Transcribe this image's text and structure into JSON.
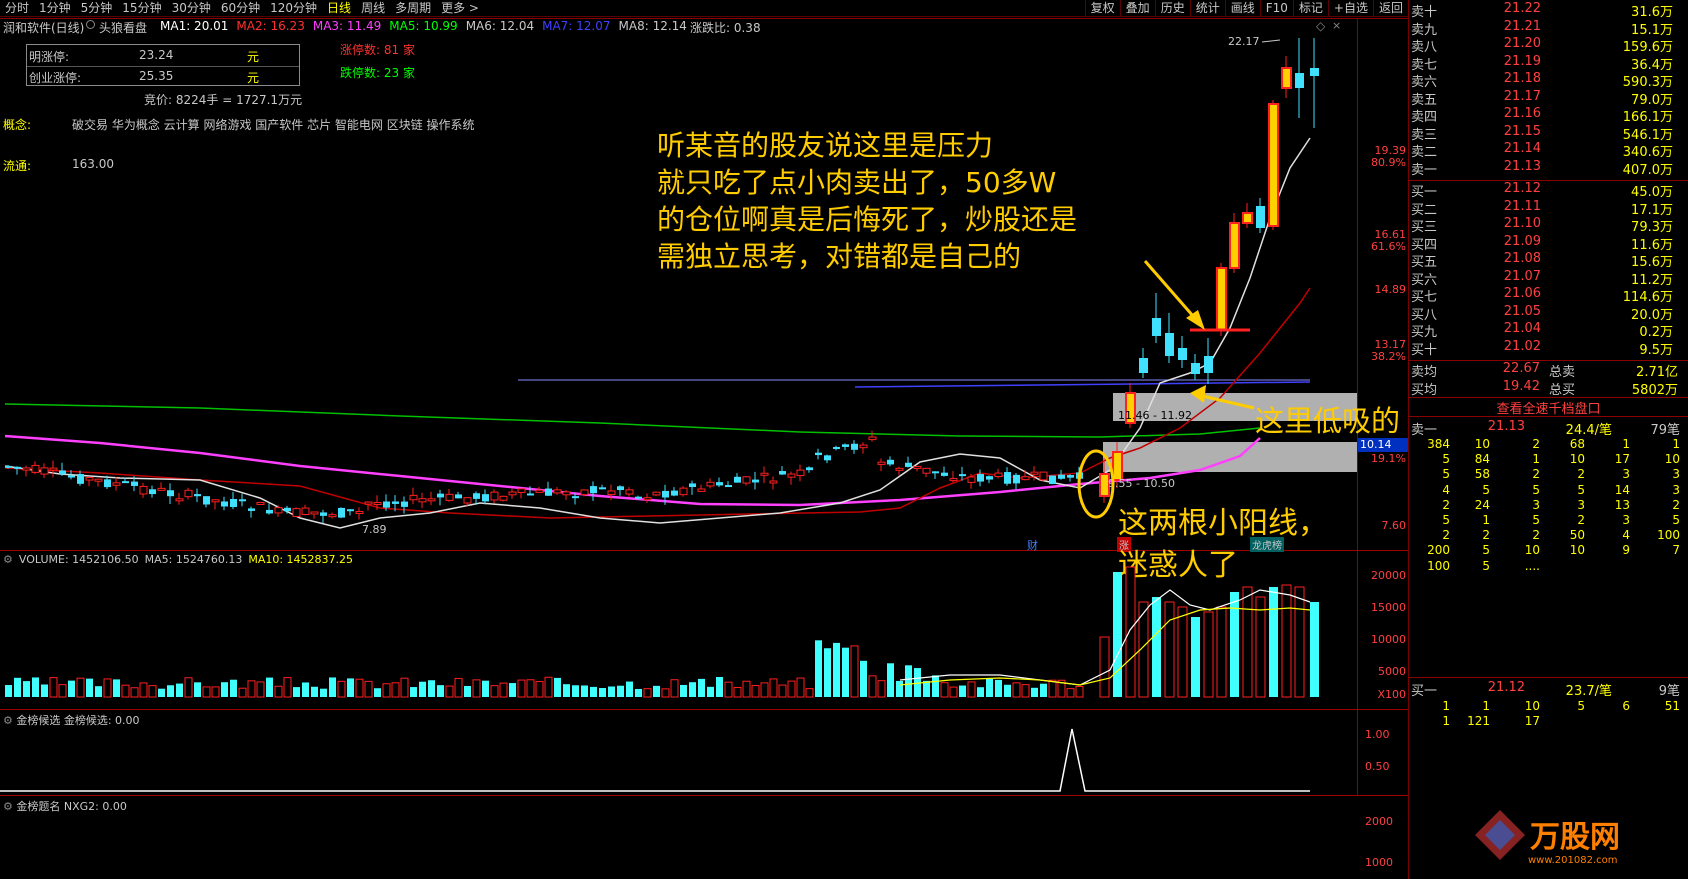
{
  "toolbar": {
    "periods": [
      "分时",
      "1分钟",
      "5分钟",
      "15分钟",
      "30分钟",
      "60分钟",
      "120分钟",
      "日线",
      "周线",
      "多周期",
      "更多 >"
    ],
    "active_period": "日线",
    "tools": [
      "复权",
      "叠加",
      "历史",
      "统计",
      "画线",
      "F10",
      "标记",
      "+自选",
      "返回"
    ]
  },
  "header": {
    "stock_name": "润和软件(日线)",
    "plugin": "头狼看盘",
    "ma": [
      {
        "label": "MA1: 20.01",
        "color": "#ffffff"
      },
      {
        "label": "MA2: 16.23",
        "color": "#ff3030"
      },
      {
        "label": "MA3: 11.49",
        "color": "#ff40ff"
      },
      {
        "label": "MA5: 10.99",
        "color": "#00ff00"
      },
      {
        "label": "MA6: 12.04",
        "color": "#c8c8c8"
      },
      {
        "label": "MA7: 12.07",
        "color": "#4040ff"
      },
      {
        "label": "MA8: 12.14",
        "color": "#c8c8c8"
      }
    ],
    "rise_fall_ratio": "涨跌比: 0.38"
  },
  "info_box": {
    "row1_label": "明涨停:",
    "row1_value": "23.24",
    "row1_unit": "元",
    "row2_label": "创业涨停:",
    "row2_value": "25.35",
    "row2_unit": "元",
    "bid": "竞价:  8224手 = 1727.1万元"
  },
  "limit_counts": {
    "up": "涨停数: 81 家",
    "down": "跌停数: 23 家"
  },
  "concepts": {
    "label": "概念:",
    "value": "破交易 华为概念 云计算 网络游戏 国产软件 芯片 智能电网 区块链 操作系统"
  },
  "float": {
    "label": "流通:",
    "value": "163.00"
  },
  "price_axis": [
    {
      "price": "19.39",
      "pct": "80.9%"
    },
    {
      "price": "16.61",
      "pct": "61.6%"
    },
    {
      "price": "14.89",
      "pct": ""
    },
    {
      "price": "13.17",
      "pct": "38.2%"
    },
    {
      "price": "10.14",
      "pct": "19.1%"
    },
    {
      "price": "7.60",
      "pct": ""
    }
  ],
  "chart_marks": {
    "high": "22.17",
    "low": "7.89",
    "zone_upper": "11.46 - 11.92",
    "zone_lower": "9.55 - 10.50",
    "tag_cai": "财",
    "tag_zhang": "涨",
    "tag_longhu": "龙虎榜"
  },
  "annotations": {
    "main_lines": [
      "听某音的股友说这里是压力",
      "就只吃了点小肉卖出了，50多W",
      " 的仓位啊真是后悔死了，炒股还是",
      "需独立思考，对错都是自己的"
    ],
    "low_buy": "这里低吸的",
    "two_yang": [
      "这两根小阳线，",
      "迷惑人了"
    ]
  },
  "volume": {
    "title": "VOLUME: 1452106.50",
    "ma5": "MA5: 1524760.13",
    "ma10": "MA10: 1452837.25",
    "axis": [
      "20000",
      "15000",
      "10000",
      "5000",
      "X100"
    ]
  },
  "ind1": {
    "title": "金榜候选",
    "value": "金榜候选: 0.00",
    "axis": [
      "1.00",
      "0.50"
    ]
  },
  "ind2": {
    "title": "金榜题名",
    "value": "NXG2: 0.00",
    "axis": [
      "2000",
      "1000"
    ]
  },
  "orderbook": {
    "sell": [
      {
        "n": "卖十",
        "p": "21.22",
        "v": "31.6万"
      },
      {
        "n": "卖九",
        "p": "21.21",
        "v": "15.1万"
      },
      {
        "n": "卖八",
        "p": "21.20",
        "v": "159.6万"
      },
      {
        "n": "卖七",
        "p": "21.19",
        "v": "36.4万"
      },
      {
        "n": "卖六",
        "p": "21.18",
        "v": "590.3万"
      },
      {
        "n": "卖五",
        "p": "21.17",
        "v": "79.0万"
      },
      {
        "n": "卖四",
        "p": "21.16",
        "v": "166.1万"
      },
      {
        "n": "卖三",
        "p": "21.15",
        "v": "546.1万"
      },
      {
        "n": "卖二",
        "p": "21.14",
        "v": "340.6万"
      },
      {
        "n": "卖一",
        "p": "21.13",
        "v": "407.0万"
      }
    ],
    "buy": [
      {
        "n": "买一",
        "p": "21.12",
        "v": "45.0万"
      },
      {
        "n": "买二",
        "p": "21.11",
        "v": "17.1万"
      },
      {
        "n": "买三",
        "p": "21.10",
        "v": "79.3万"
      },
      {
        "n": "买四",
        "p": "21.09",
        "v": "11.6万"
      },
      {
        "n": "买五",
        "p": "21.08",
        "v": "15.6万"
      },
      {
        "n": "买六",
        "p": "21.07",
        "v": "11.2万"
      },
      {
        "n": "买七",
        "p": "21.06",
        "v": "114.6万"
      },
      {
        "n": "买八",
        "p": "21.05",
        "v": "20.0万"
      },
      {
        "n": "买九",
        "p": "21.04",
        "v": "0.2万"
      },
      {
        "n": "买十",
        "p": "21.02",
        "v": "9.5万"
      }
    ],
    "avg_sell_label": "卖均",
    "avg_sell": "22.67",
    "total_sell_label": "总卖",
    "total_sell": "2.71亿",
    "avg_buy_label": "买均",
    "avg_buy": "19.42",
    "total_buy_label": "总买",
    "total_buy": "5802万",
    "link": "查看全速千档盘口"
  },
  "queue_sell": {
    "label": "卖一",
    "price": "21.13",
    "avg": "24.4/笔",
    "count": "79笔",
    "rows": [
      [
        "384",
        "10",
        "2",
        "68",
        "1",
        "1"
      ],
      [
        "5",
        "84",
        "1",
        "10",
        "17",
        "10"
      ],
      [
        "5",
        "58",
        "2",
        "2",
        "3",
        "3"
      ],
      [
        "4",
        "5",
        "5",
        "5",
        "14",
        "3"
      ],
      [
        "2",
        "24",
        "3",
        "3",
        "13",
        "2"
      ],
      [
        "5",
        "1",
        "5",
        "2",
        "3",
        "5"
      ],
      [
        "2",
        "2",
        "2",
        "50",
        "4",
        "100"
      ],
      [
        "200",
        "5",
        "10",
        "10",
        "9",
        "7"
      ],
      [
        "100",
        "5",
        "....",
        "",
        "",
        ""
      ]
    ]
  },
  "queue_buy": {
    "label": "买一",
    "price": "21.12",
    "avg": "23.7/笔",
    "count": "9笔",
    "rows": [
      [
        "1",
        "1",
        "10",
        "5",
        "6",
        "51"
      ],
      [
        "1",
        "121",
        "17",
        "",
        "",
        ""
      ]
    ]
  },
  "watermark": {
    "brand": "万股网",
    "url": "www.201082.com"
  }
}
